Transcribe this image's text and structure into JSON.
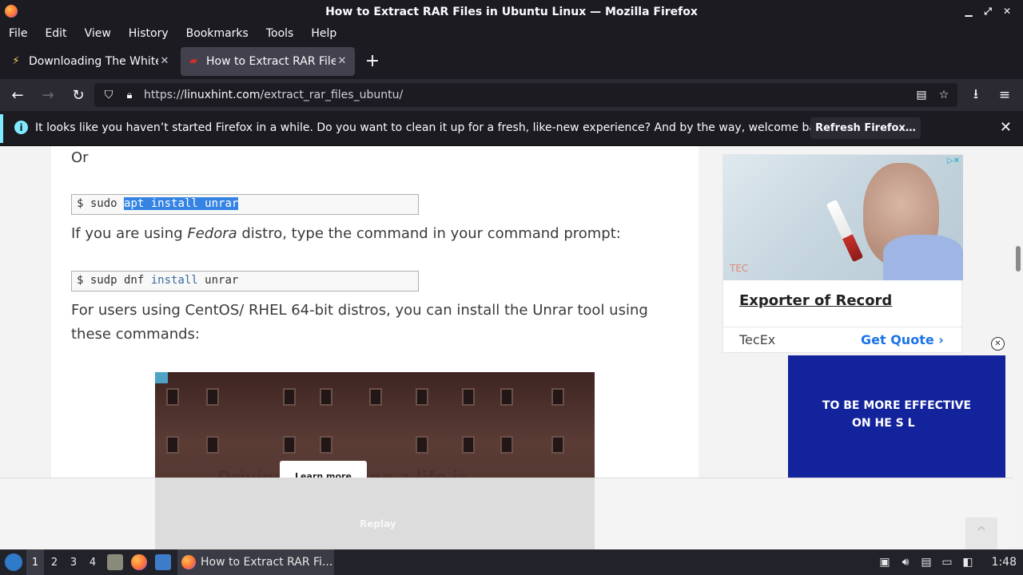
{
  "window": {
    "title": "How to Extract RAR Files in Ubuntu Linux — Mozilla Firefox",
    "controls": [
      "minimize-icon",
      "restore-icon",
      "close-icon"
    ]
  },
  "menu": [
    "File",
    "Edit",
    "View",
    "History",
    "Bookmarks",
    "Tools",
    "Help"
  ],
  "tabs": [
    {
      "title": "Downloading The White House",
      "icon": "lightning-icon",
      "active": false
    },
    {
      "title": "How to Extract RAR Files in Ubuntu Linux",
      "icon": "site-favicon",
      "active": true
    }
  ],
  "nav": {
    "url_prefix": "https://",
    "url_domain": "linuxhint.com",
    "url_path": "/extract_rar_files_ubuntu/"
  },
  "notification": {
    "message": "It looks like you haven’t started Firefox in a while. Do you want to clean it up for a fresh, like-new experience? And by the way, welcome back!",
    "button": "Refresh Firefox…"
  },
  "article": {
    "or_text": "Or",
    "cmd1": {
      "prompt": "$ sudo ",
      "selected": "apt install unrar"
    },
    "para1_a": "If you are using ",
    "para1_em": "Fedora",
    "para1_b": " distro, type the command in your command prompt:",
    "cmd2": {
      "prompt": "$ sudp dnf ",
      "keyword": "install",
      "rest": " unrar"
    },
    "para2_line1": "For users using CentOS/ RHEL 64-bit distros, you can install the Unrar tool using",
    "para2_line2": "these commands:",
    "video_overlay_text": "Driving isn't ... ing a life is",
    "learn_more": "Learn more",
    "replay": "Replay"
  },
  "ads": {
    "ad1": {
      "logo": "TEC",
      "headline": "Exporter of Record",
      "brand": "TecEx",
      "cta": "Get Quote ›"
    },
    "ad2": {
      "line1": "TO BE MORE EFFECTIVE",
      "line2": "ON  HE S    L"
    }
  },
  "taskbar": {
    "workspaces": [
      "1",
      "2",
      "3",
      "4"
    ],
    "active_workspace": "1",
    "task_label": "How to Extract RAR Fi...",
    "clock": "1:48"
  },
  "colors": {
    "firefox_dark": "#1c1b22",
    "info_accent": "#80ebff",
    "selection": "#3584e4",
    "ad_blue": "#12239b",
    "cta_blue": "#1a73e8"
  }
}
